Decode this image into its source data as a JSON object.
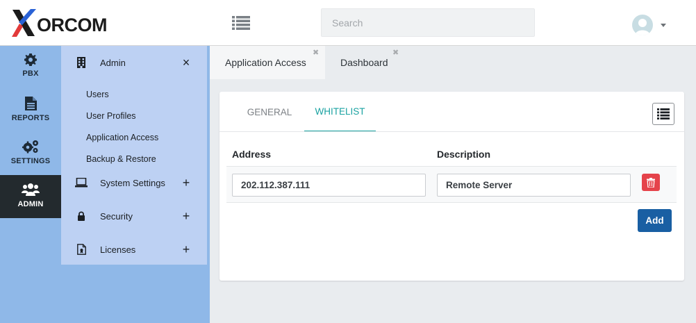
{
  "header": {
    "logo_text": "ORCOM",
    "search_placeholder": "Search"
  },
  "rail": {
    "items": [
      {
        "label": "PBX",
        "icon": "gear-icon"
      },
      {
        "label": "REPORTS",
        "icon": "document-icon"
      },
      {
        "label": "SETTINGS",
        "icon": "gears-icon"
      },
      {
        "label": "ADMIN",
        "icon": "users-icon",
        "active": true
      }
    ]
  },
  "submenu": {
    "admin": {
      "label": "Admin",
      "icon": "building-icon",
      "action": "×"
    },
    "admin_items": [
      "Users",
      "User Profiles",
      "Application Access",
      "Backup & Restore"
    ],
    "system_settings": {
      "label": "System Settings",
      "icon": "laptop-icon",
      "action": "+"
    },
    "security": {
      "label": "Security",
      "icon": "lock-icon",
      "action": "+"
    },
    "licenses": {
      "label": "Licenses",
      "icon": "license-file-icon",
      "action": "+"
    }
  },
  "tabs": [
    {
      "label": "Application Access",
      "active": true,
      "close": "✖"
    },
    {
      "label": "Dashboard",
      "active": false,
      "close": "✖"
    }
  ],
  "panel": {
    "tabs": {
      "general": "GENERAL",
      "whitelist": "WHITELIST"
    },
    "active_tab": "WHITELIST",
    "columns": {
      "address": "Address",
      "description": "Description"
    },
    "rows": [
      {
        "address": "202.112.387.111",
        "description": "Remote Server"
      }
    ],
    "add_label": "Add"
  },
  "colors": {
    "rail_bg": "#8fb8e8",
    "submenu_bg": "#bdd1f3",
    "active_rail": "#232a2e",
    "accent_teal": "#1aa2a1",
    "add_button": "#195fa3",
    "delete_button": "#e5434b"
  }
}
